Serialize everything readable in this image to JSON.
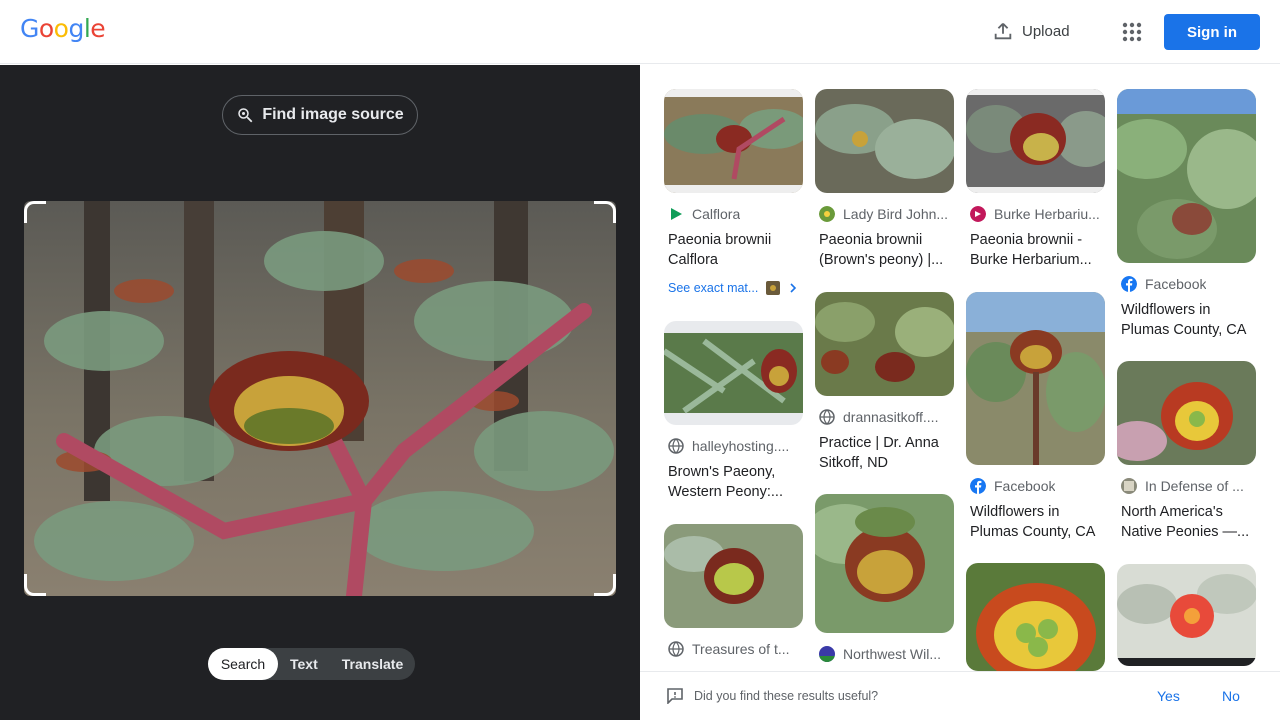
{
  "header": {
    "logo_letters": [
      "G",
      "o",
      "o",
      "g",
      "l",
      "e"
    ],
    "upload_label": "Upload",
    "signin_label": "Sign in"
  },
  "left": {
    "find_source_label": "Find image source",
    "modes": [
      "Search",
      "Text",
      "Translate"
    ],
    "active_mode": "Search"
  },
  "results": [
    {
      "source": "Calflora",
      "title": "Paeonia brownii Calflora",
      "source_icon": "green-play-icon",
      "exact_matches": "See exact mat..."
    },
    {
      "source": "Lady Bird John...",
      "title": "Paeonia brownii (Brown's peony) |...",
      "source_icon": "lady-bird-logo-icon"
    },
    {
      "source": "Burke Herbariu...",
      "title": "Paeonia brownii - Burke Herbarium...",
      "source_icon": "burke-logo-icon"
    },
    {
      "source": "Facebook",
      "title": "Wildflowers in Plumas County, CA",
      "source_icon": "facebook-icon"
    },
    {
      "source": "halleyhosting....",
      "title": "Brown's Paeony, Western Peony:...",
      "source_icon": "globe-icon"
    },
    {
      "source": "drannasitkoff....",
      "title": "Practice | Dr. Anna Sitkoff, ND",
      "source_icon": "globe-icon"
    },
    {
      "source": "Facebook",
      "title": "Wildflowers in Plumas County, CA",
      "source_icon": "facebook-icon"
    },
    {
      "source": "In Defense of ...",
      "title": "North America's Native Peonies —...",
      "source_icon": "in-defense-logo-icon"
    },
    {
      "source": "Treasures of t...",
      "title": "",
      "source_icon": "globe-icon"
    },
    {
      "source": "Northwest Wil...",
      "title": "",
      "source_icon": "northwest-logo-icon"
    }
  ],
  "feedback": {
    "question": "Did you find these results useful?",
    "yes": "Yes",
    "no": "No"
  },
  "colors": {
    "brand_blue": "#1a73e8",
    "left_bg": "#202124",
    "google_blue": "#4285F4",
    "google_red": "#EA4335",
    "google_yellow": "#FBBC05",
    "google_green": "#34A853"
  }
}
